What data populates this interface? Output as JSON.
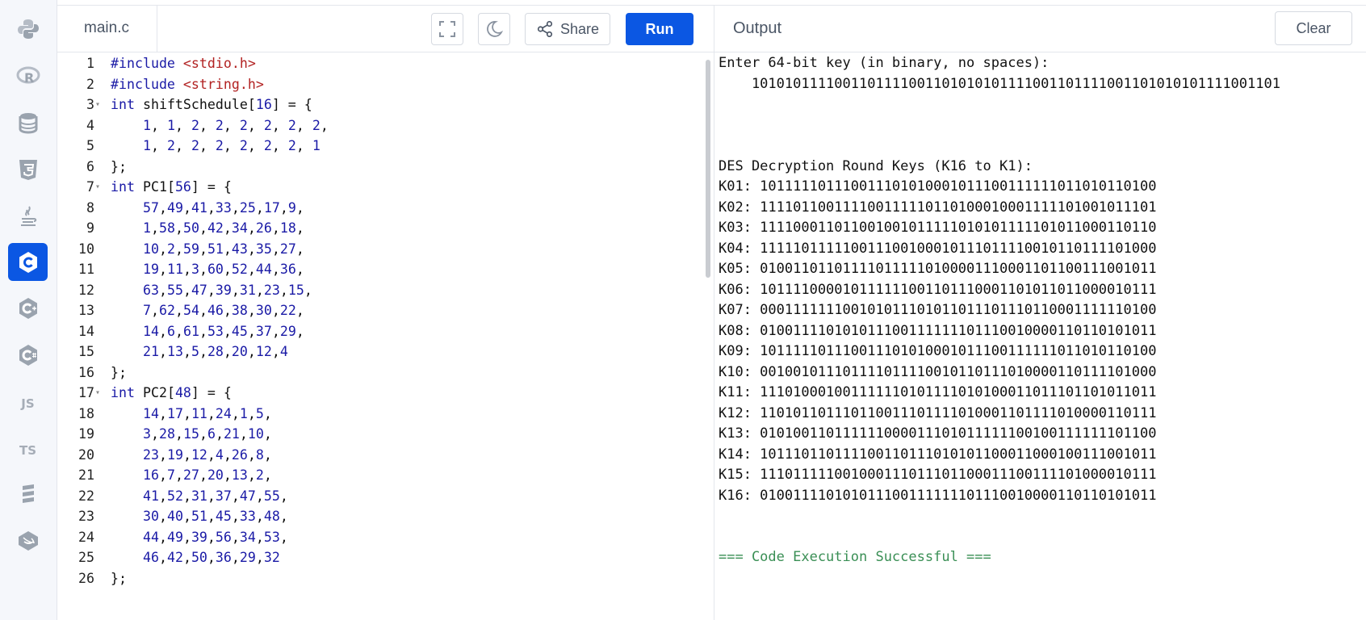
{
  "rail": {
    "items": [
      {
        "name": "python-icon"
      },
      {
        "name": "r-icon"
      },
      {
        "name": "database-icon"
      },
      {
        "name": "html5-icon"
      },
      {
        "name": "java-icon"
      },
      {
        "name": "c-icon",
        "active": true
      },
      {
        "name": "cpp-icon"
      },
      {
        "name": "csharp-icon"
      },
      {
        "name": "javascript-icon",
        "label": "JS"
      },
      {
        "name": "typescript-icon",
        "label": "TS"
      },
      {
        "name": "scala-icon"
      },
      {
        "name": "swift-icon"
      }
    ]
  },
  "editor": {
    "file_name": "main.c",
    "share_label": "Share",
    "run_label": "Run",
    "lines": [
      {
        "n": "1",
        "t": "#include <stdio.h>"
      },
      {
        "n": "2",
        "t": "#include <string.h>"
      },
      {
        "n": "3",
        "t": "int shiftSchedule[16] = {",
        "fold": true
      },
      {
        "n": "4",
        "t": "    1, 1, 2, 2, 2, 2, 2, 2,"
      },
      {
        "n": "5",
        "t": "    1, 2, 2, 2, 2, 2, 2, 1"
      },
      {
        "n": "6",
        "t": "};"
      },
      {
        "n": "7",
        "t": "int PC1[56] = {",
        "fold": true
      },
      {
        "n": "8",
        "t": "    57,49,41,33,25,17,9,"
      },
      {
        "n": "9",
        "t": "    1,58,50,42,34,26,18,"
      },
      {
        "n": "10",
        "t": "    10,2,59,51,43,35,27,"
      },
      {
        "n": "11",
        "t": "    19,11,3,60,52,44,36,"
      },
      {
        "n": "12",
        "t": "    63,55,47,39,31,23,15,"
      },
      {
        "n": "13",
        "t": "    7,62,54,46,38,30,22,"
      },
      {
        "n": "14",
        "t": "    14,6,61,53,45,37,29,"
      },
      {
        "n": "15",
        "t": "    21,13,5,28,20,12,4"
      },
      {
        "n": "16",
        "t": "};"
      },
      {
        "n": "17",
        "t": "int PC2[48] = {",
        "fold": true
      },
      {
        "n": "18",
        "t": "    14,17,11,24,1,5,"
      },
      {
        "n": "19",
        "t": "    3,28,15,6,21,10,"
      },
      {
        "n": "20",
        "t": "    23,19,12,4,26,8,"
      },
      {
        "n": "21",
        "t": "    16,7,27,20,13,2,"
      },
      {
        "n": "22",
        "t": "    41,52,31,37,47,55,"
      },
      {
        "n": "23",
        "t": "    30,40,51,45,33,48,"
      },
      {
        "n": "24",
        "t": "    44,49,39,56,34,53,"
      },
      {
        "n": "25",
        "t": "    46,42,50,36,29,32"
      },
      {
        "n": "26",
        "t": "};"
      }
    ]
  },
  "output": {
    "title": "Output",
    "clear_label": "Clear",
    "lines": [
      {
        "t": "Enter 64-bit key (in binary, no spaces):"
      },
      {
        "t": "    1010101111001101111001101010101111001101111001101010101111001101"
      },
      {
        "t": ""
      },
      {
        "t": ""
      },
      {
        "t": ""
      },
      {
        "t": "DES Decryption Round Keys (K16 to K1):"
      },
      {
        "t": "K01: 101111101110011101010001011100111111011010110100"
      },
      {
        "t": "K02: 111101100111100111110110100010001111101001011101"
      },
      {
        "t": "K03: 111100011011001001011111010101111101011000110110"
      },
      {
        "t": "K04: 111110111110011100100010111011110010110111101000"
      },
      {
        "t": "K05: 010011011011110111110100001110001101100111001011"
      },
      {
        "t": "K06: 101111000010111111001101110001101011011000010111"
      },
      {
        "t": "K07: 000111111100101011101011011101110110001111110100"
      },
      {
        "t": "K08: 010011110101011100111111101110010000110110101011"
      },
      {
        "t": "K09: 101111101110011101010001011100111111011010110100"
      },
      {
        "t": "K10: 001001011101111011110010110111010000110111101000"
      },
      {
        "t": "K11: 111010001001111110101111010100011011101101011011"
      },
      {
        "t": "K12: 110101101110110011101111010001101111010000110111"
      },
      {
        "t": "K13: 010100110111111000011101011111100100111111101100"
      },
      {
        "t": "K14: 101110110111100110111010101100011000100111001011"
      },
      {
        "t": "K15: 111011111001000111011101100011100111101000010111"
      },
      {
        "t": "K16: 010011110101011100111111101110010000110110101011"
      },
      {
        "t": ""
      },
      {
        "t": ""
      },
      {
        "t": "=== Code Execution Successful ===",
        "success": true
      }
    ]
  }
}
